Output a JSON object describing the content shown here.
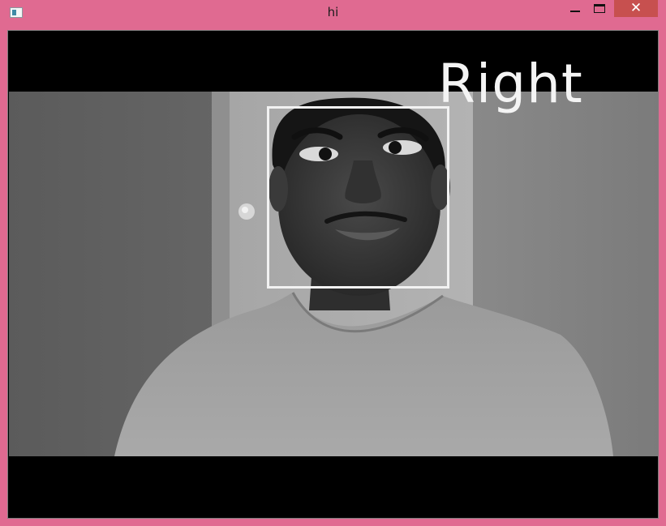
{
  "window": {
    "title": "hi",
    "close_glyph": "✕"
  },
  "icons": {
    "app": "app-window-icon",
    "minimize": "minimize-icon",
    "maximize": "maximize-icon",
    "close": "close-icon"
  },
  "colors": {
    "window_frame": "#e06a91",
    "close_button": "#c7504f",
    "overlay": "#f4f4f4",
    "letterbox": "#000000"
  },
  "video": {
    "direction_label": "Right"
  }
}
